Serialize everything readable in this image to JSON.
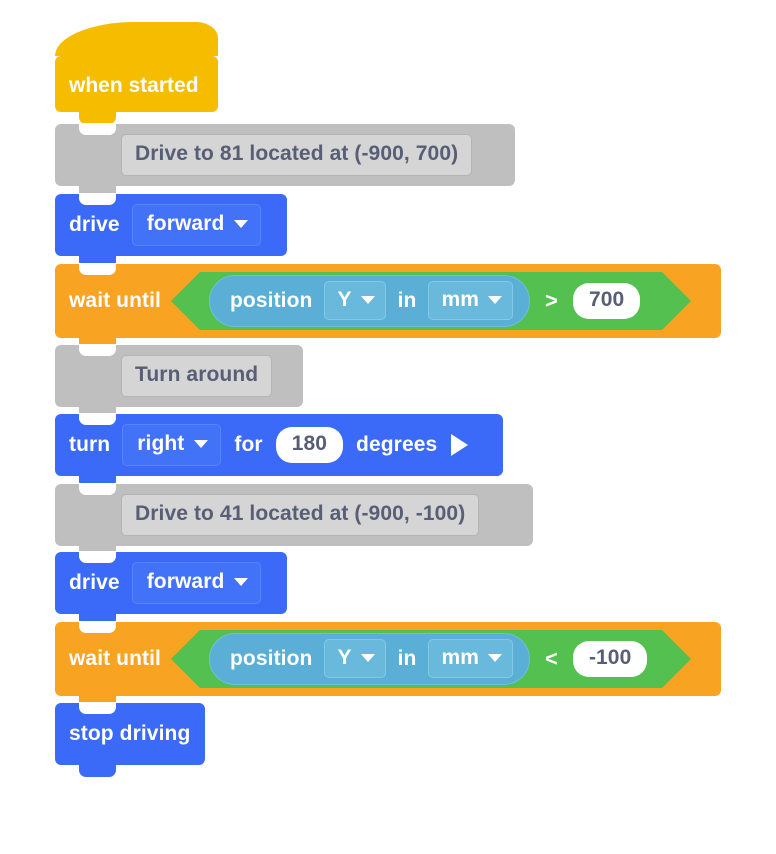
{
  "program": {
    "title": "when started",
    "blocks": [
      {
        "kind": "hat",
        "label": "when started"
      },
      {
        "kind": "comment",
        "text": "Drive to 81 located at (-900, 700)"
      },
      {
        "kind": "motion_dropdown",
        "label": "drive",
        "dropdown_value": "forward",
        "dropdown_icon": "chevron-down-icon"
      },
      {
        "kind": "wait_until",
        "label": "wait until",
        "condition": {
          "reporter_label": "position",
          "axis_value": "Y",
          "axis_icon": "chevron-down-icon",
          "in_word": "in",
          "unit_value": "mm",
          "unit_icon": "chevron-down-icon",
          "operator": ">",
          "compare_value": "700"
        }
      },
      {
        "kind": "comment",
        "text": "Turn around"
      },
      {
        "kind": "turn",
        "label": "turn",
        "dropdown_value": "right",
        "dropdown_icon": "chevron-down-icon",
        "for_word": "for",
        "amount": "180",
        "unit_word": "degrees",
        "run_icon": "play-triangle-icon"
      },
      {
        "kind": "comment",
        "text": "Drive to 41 located at (-900, -100)"
      },
      {
        "kind": "motion_dropdown",
        "label": "drive",
        "dropdown_value": "forward",
        "dropdown_icon": "chevron-down-icon"
      },
      {
        "kind": "wait_until",
        "label": "wait until",
        "condition": {
          "reporter_label": "position",
          "axis_value": "Y",
          "axis_icon": "chevron-down-icon",
          "in_word": "in",
          "unit_value": "mm",
          "unit_icon": "chevron-down-icon",
          "operator": "<",
          "compare_value": "-100"
        }
      },
      {
        "kind": "stop",
        "label": "stop driving"
      }
    ]
  },
  "colors": {
    "hat_yellow": "#f5bc00",
    "motion_blue": "#3a6af7",
    "control_orange": "#f9a323",
    "operator_green": "#54c04f",
    "sensing_blue": "#5bafd6",
    "comment_gray": "#bfbfbf",
    "comment_field_gray": "#d5d5d5",
    "comment_text": "#575e75",
    "value_text": "#575e75",
    "canvas": "#ffffff"
  }
}
